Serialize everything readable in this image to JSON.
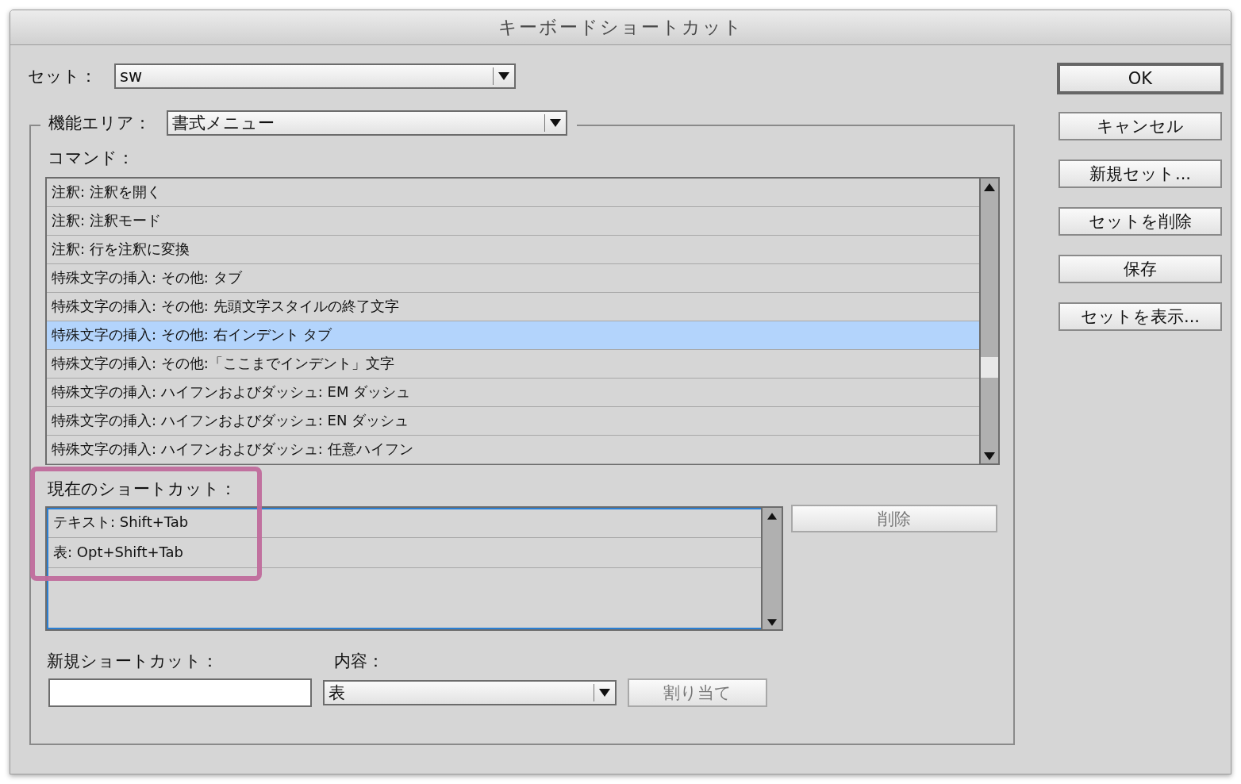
{
  "window": {
    "title": "キーボードショートカット"
  },
  "set": {
    "label": "セット：",
    "value": "sw"
  },
  "feature_area": {
    "label": "機能エリア：",
    "value": "書式メニュー"
  },
  "commands": {
    "label": "コマンド：",
    "items": [
      {
        "text": "注釈: 注釈を開く",
        "selected": false
      },
      {
        "text": "注釈: 注釈モード",
        "selected": false
      },
      {
        "text": "注釈: 行を注釈に変換",
        "selected": false
      },
      {
        "text": "特殊文字の挿入: その他: タブ",
        "selected": false
      },
      {
        "text": "特殊文字の挿入: その他: 先頭文字スタイルの終了文字",
        "selected": false
      },
      {
        "text": "特殊文字の挿入: その他: 右インデント タブ",
        "selected": true
      },
      {
        "text": "特殊文字の挿入: その他:「ここまでインデント」文字",
        "selected": false
      },
      {
        "text": "特殊文字の挿入: ハイフンおよびダッシュ: EM ダッシュ",
        "selected": false
      },
      {
        "text": "特殊文字の挿入: ハイフンおよびダッシュ: EN ダッシュ",
        "selected": false
      },
      {
        "text": "特殊文字の挿入: ハイフンおよびダッシュ: 任意ハイフン",
        "selected": false
      }
    ]
  },
  "current_shortcuts": {
    "label": "現在のショートカット：",
    "items": [
      "テキスト: Shift+Tab",
      "表: Opt+Shift+Tab"
    ],
    "delete_button": {
      "label": "削除",
      "disabled": true
    },
    "highlighted": true
  },
  "new_shortcut": {
    "label": "新規ショートカット：",
    "context_label": "内容：",
    "context_value": "表",
    "assign_button": {
      "label": "割り当て",
      "disabled": true
    }
  },
  "buttons": [
    {
      "label": "OK",
      "default": true
    },
    {
      "label": "キャンセル",
      "default": false
    },
    {
      "label": "新規セット...",
      "default": false
    },
    {
      "label": "セットを削除",
      "default": false
    },
    {
      "label": "保存",
      "default": false
    },
    {
      "label": "セットを表示...",
      "default": false
    }
  ]
}
